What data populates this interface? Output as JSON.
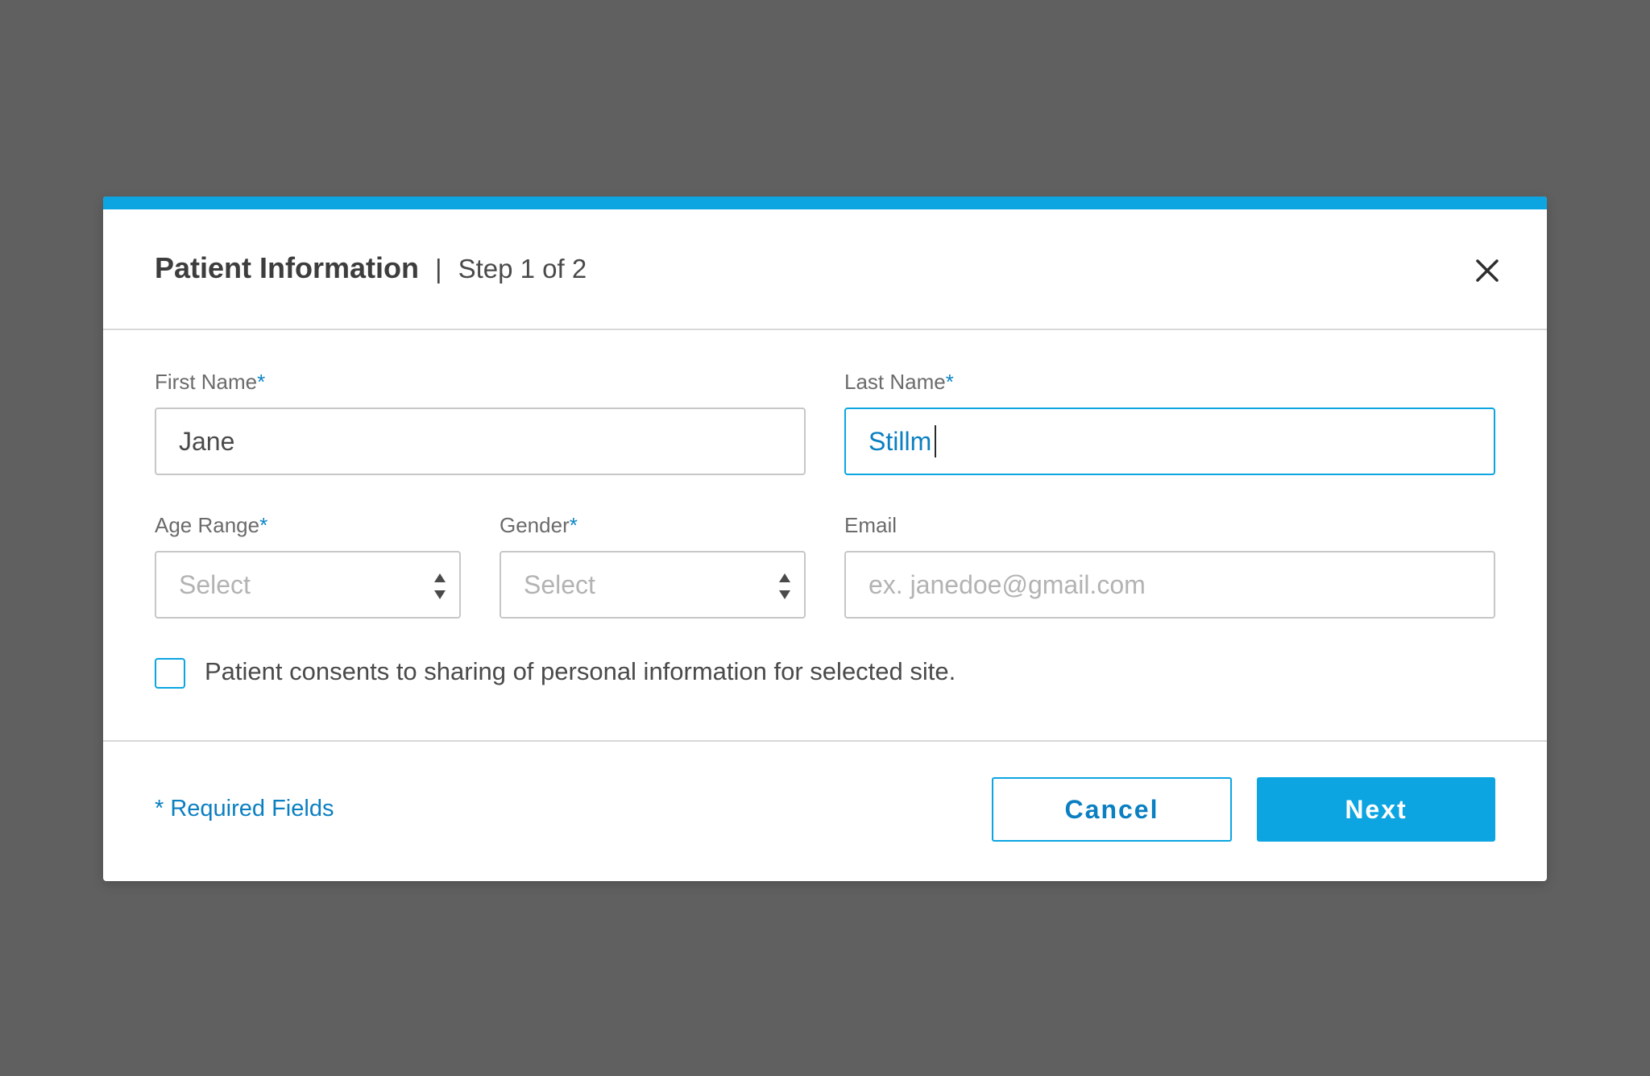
{
  "modal": {
    "title": "Patient Information",
    "separator": "|",
    "step": "Step 1 of 2",
    "close_icon": "close-icon"
  },
  "fields": {
    "first_name": {
      "label": "First Name",
      "required_mark": "*",
      "value": "Jane"
    },
    "last_name": {
      "label": "Last Name",
      "required_mark": "*",
      "value": "Stillm"
    },
    "age_range": {
      "label": "Age Range",
      "required_mark": "*",
      "placeholder": "Select",
      "icon": "select-arrows-icon"
    },
    "gender": {
      "label": "Gender",
      "required_mark": "*",
      "placeholder": "Select",
      "icon": "select-arrows-icon"
    },
    "email": {
      "label": "Email",
      "placeholder": "ex. janedoe@gmail.com"
    }
  },
  "consent": {
    "checked": false,
    "label": "Patient consents to sharing of personal information for selected site."
  },
  "footer": {
    "required_note": "* Required Fields",
    "cancel_label": "Cancel",
    "next_label": "Next"
  },
  "colors": {
    "accent": "#0ca5e2",
    "link": "#0a7fc1",
    "overlay": "#606060"
  }
}
